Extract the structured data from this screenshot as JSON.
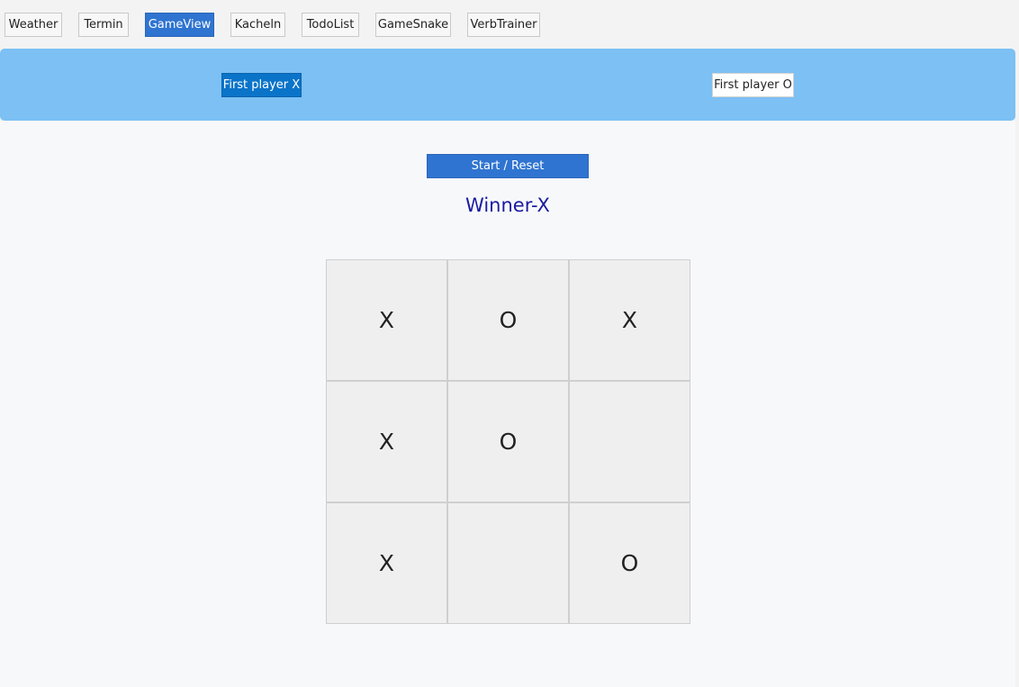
{
  "nav": {
    "items": [
      {
        "label": "Weather",
        "active": false
      },
      {
        "label": "Termin",
        "active": false
      },
      {
        "label": "GameView",
        "active": true
      },
      {
        "label": "Kacheln",
        "active": false
      },
      {
        "label": "TodoList",
        "active": false
      },
      {
        "label": "GameSnake",
        "active": false
      },
      {
        "label": "VerbTrainer",
        "active": false
      }
    ]
  },
  "players": {
    "first_x_label": "First player X",
    "first_o_label": "First player O",
    "selected": "X"
  },
  "game": {
    "start_reset_label": "Start / Reset",
    "status": "Winner-X",
    "board": [
      [
        "X",
        "O",
        "X"
      ],
      [
        "X",
        "O",
        ""
      ],
      [
        "X",
        "",
        "O"
      ]
    ]
  },
  "colors": {
    "accent": "#2f74d0",
    "player_bar": "#7cc0f4",
    "selected_player": "#0a74c9",
    "status_text": "#1a1aa0"
  }
}
